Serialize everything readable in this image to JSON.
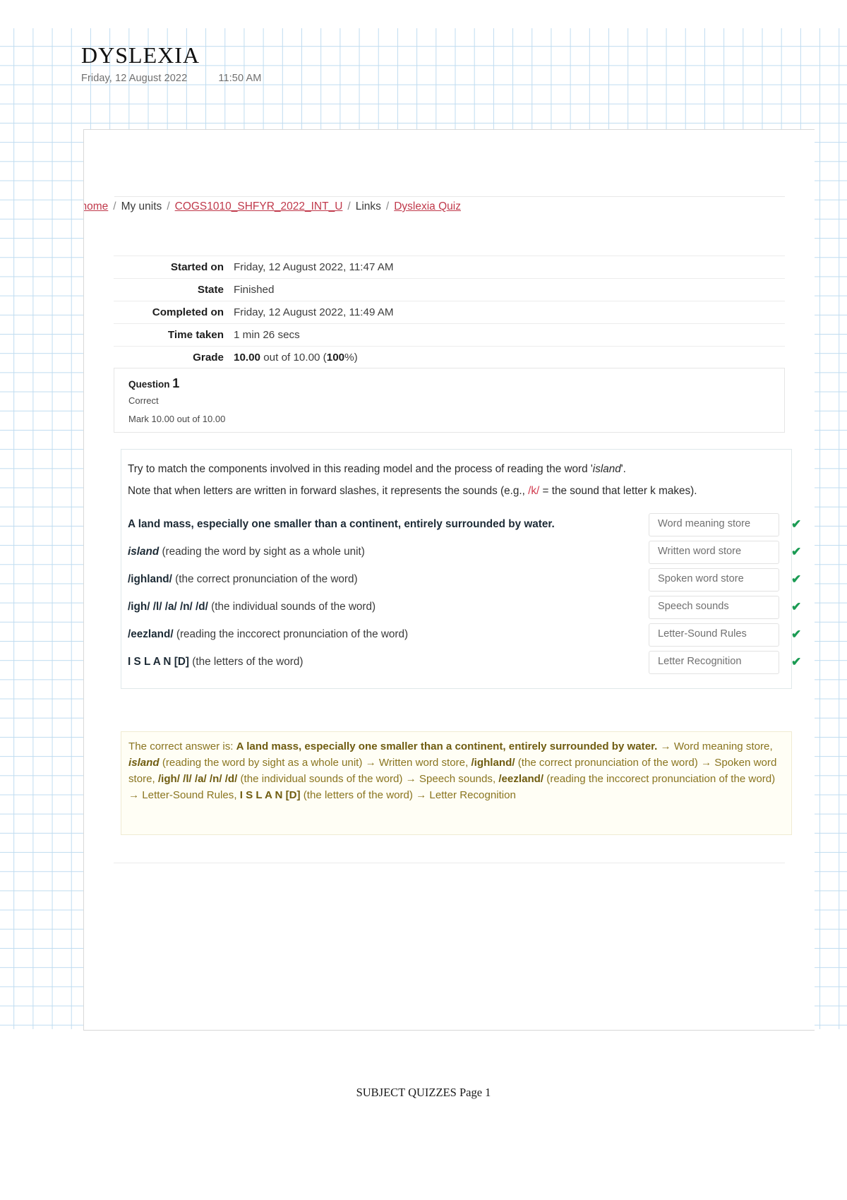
{
  "header": {
    "title": "DYSLEXIA",
    "date": "Friday, 12 August 2022",
    "time": "11:50 AM"
  },
  "breadcrumb": {
    "items": [
      {
        "label": "ly home",
        "link": true
      },
      {
        "label": "My units",
        "link": false
      },
      {
        "label": "COGS1010_SHFYR_2022_INT_U",
        "link": true
      },
      {
        "label": "Links",
        "link": false
      },
      {
        "label": "Dyslexia Quiz",
        "link": true
      }
    ],
    "separator": "/"
  },
  "summary": {
    "rows": [
      {
        "label": "Started on",
        "value": "Friday, 12 August 2022, 11:47 AM"
      },
      {
        "label": "State",
        "value": "Finished"
      },
      {
        "label": "Completed on",
        "value": "Friday, 12 August 2022, 11:49 AM"
      },
      {
        "label": "Time taken",
        "value": "1 min 26 secs"
      }
    ],
    "grade_label": "Grade",
    "grade_score": "10.00",
    "grade_middle": " out of 10.00 (",
    "grade_percent": "100",
    "grade_suffix": "%)"
  },
  "question_info": {
    "title_word": "Question",
    "number": "1",
    "state": "Correct",
    "mark": "Mark 10.00 out of 10.00"
  },
  "question": {
    "line1_a": "Try to match the components involved in this reading model and the process of reading the word '",
    "line1_italic": "island",
    "line1_b": "'.",
    "line2_a": "Note that when letters are written in forward slashes, it represents the sounds (e.g., ",
    "line2_sound": "/k/",
    "line2_b": " = the sound that letter k makes).",
    "rows": [
      {
        "bold": "A land mass, especially one smaller than a continent, entirely surrounded by water.",
        "bold_italic": false,
        "rest": "",
        "answer": "Word meaning store",
        "tick": "✔"
      },
      {
        "bold": "island",
        "bold_italic": true,
        "rest": " (reading the word by sight as a whole unit)",
        "answer": "Written word store",
        "tick": "✔"
      },
      {
        "bold": "/ighland/",
        "bold_italic": false,
        "rest": " (the correct pronunciation of the word)",
        "answer": "Spoken word store",
        "tick": "✔"
      },
      {
        "bold": "/igh/ /l/ /a/ /n/ /d/",
        "bold_italic": false,
        "rest": " (the individual sounds of the word)",
        "answer": "Speech sounds",
        "tick": "✔"
      },
      {
        "bold": "/eezland/",
        "bold_italic": false,
        "rest": " (reading the inccorect pronunciation of the word)",
        "answer": "Letter-Sound Rules",
        "tick": "✔"
      },
      {
        "bold": "I S L A N [D]",
        "bold_italic": false,
        "rest": " (the letters of the word)",
        "answer": "Letter Recognition",
        "tick": "✔"
      }
    ]
  },
  "feedback": {
    "intro": "The correct answer is: ",
    "parts": [
      {
        "text": "A land mass, especially one smaller than a continent, entirely surrounded by water.",
        "bold": true,
        "italic": false
      },
      {
        "text": " → Word meaning store, ",
        "bold": false,
        "italic": false
      },
      {
        "text": "island",
        "bold": true,
        "italic": true
      },
      {
        "text": " (reading the word by sight as a whole unit) → Written word store, ",
        "bold": false,
        "italic": false
      },
      {
        "text": "/ighland/",
        "bold": true,
        "italic": false
      },
      {
        "text": " (the correct pronunciation of the word) → Spoken word store, ",
        "bold": false,
        "italic": false
      },
      {
        "text": "/igh/ /l/ /a/ /n/ /d/",
        "bold": true,
        "italic": false
      },
      {
        "text": " (the individual sounds of the word) → Speech sounds, ",
        "bold": false,
        "italic": false
      },
      {
        "text": "/eezland/",
        "bold": true,
        "italic": false
      },
      {
        "text": " (reading the inccorect pronunciation of the word) → Letter-Sound Rules, ",
        "bold": false,
        "italic": false
      },
      {
        "text": "I S L A N [D]",
        "bold": true,
        "italic": false
      },
      {
        "text": " (the letters of the word) → Letter Recognition",
        "bold": false,
        "italic": false
      }
    ]
  },
  "footer": {
    "text": "SUBJECT QUIZZES Page 1"
  },
  "colors": {
    "grid_line": "#bfdcf0",
    "link": "#c0394b",
    "tick_green": "#1a9b53",
    "feedback_text": "#8a7520",
    "feedback_bg": "#fffef5"
  }
}
